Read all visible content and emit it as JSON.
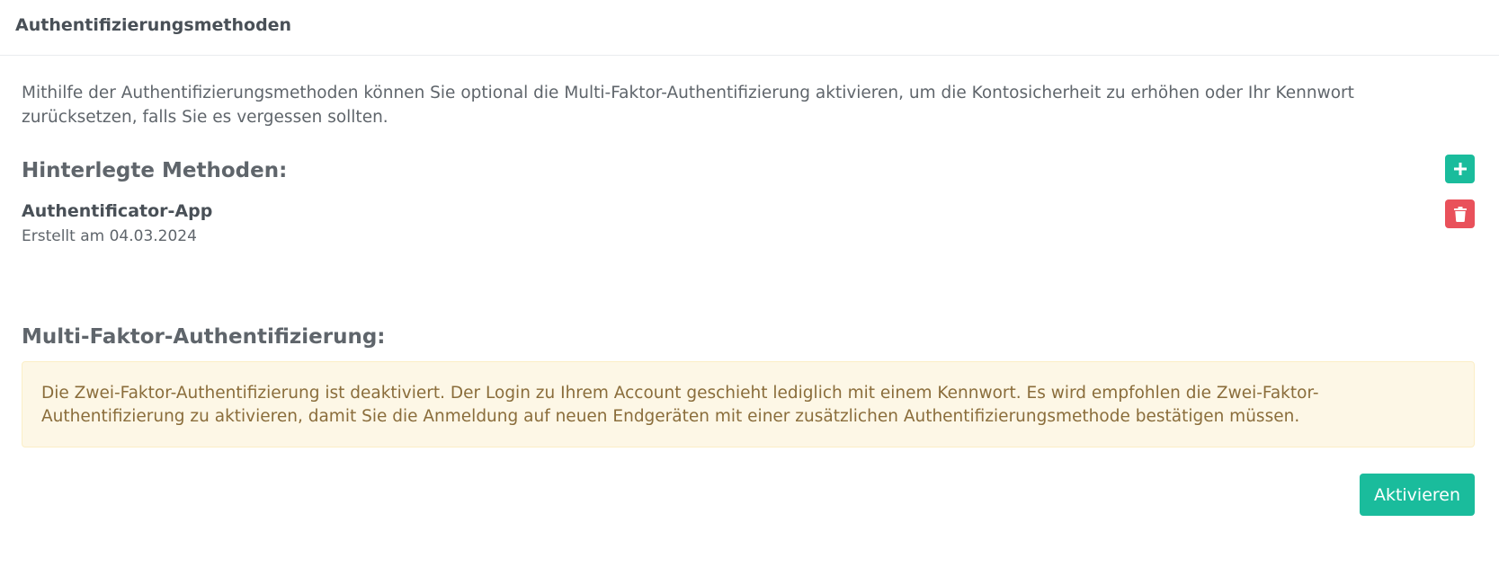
{
  "header": {
    "title": "Authentifizierungsmethoden"
  },
  "intro": {
    "text": "Mithilfe der Authentifizierungsmethoden können Sie optional die Multi-Faktor-Authentifizierung aktivieren, um die Kontosicherheit zu erhöhen oder Ihr Kennwort zurücksetzen, falls Sie es vergessen sollten."
  },
  "methods": {
    "title": "Hinterlegte Methoden:",
    "add_icon": "plus-icon",
    "items": [
      {
        "name": "Authentificator-App",
        "created": "Erstellt am 04.03.2024",
        "delete_icon": "trash-icon"
      }
    ]
  },
  "mfa": {
    "title": "Multi-Faktor-Authentifizierung:",
    "alert_text": "Die Zwei-Faktor-Authentifizierung ist deaktiviert. Der Login zu Ihrem Account geschieht lediglich mit einem Kennwort. Es wird empfohlen die Zwei-Faktor-Authentifizierung zu aktivieren, damit Sie die Anmeldung auf neuen Endgeräten mit einer zusätzlichen Authentifizierungsmethode bestätigen müssen.",
    "activate_label": "Aktivieren"
  },
  "colors": {
    "accent": "#1abc9c",
    "danger": "#e9515b",
    "warning_bg": "#fdf7e6",
    "warning_text": "#8a6d3b"
  }
}
